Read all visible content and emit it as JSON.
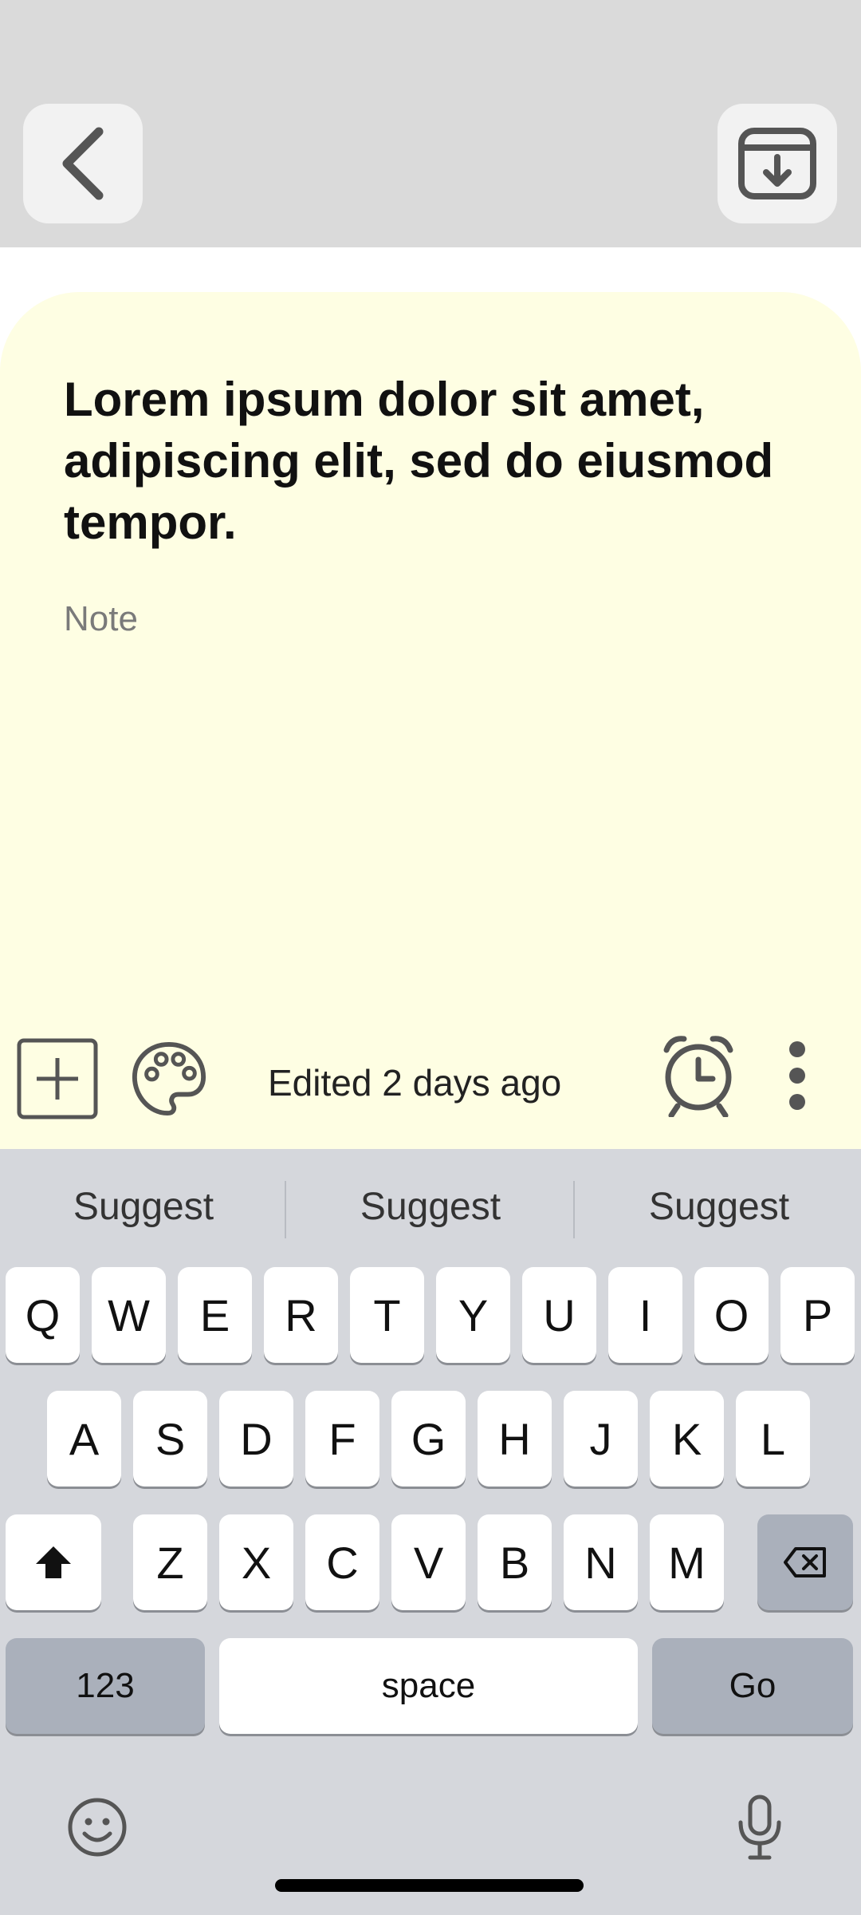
{
  "top_bar": {
    "back_icon": "chevron-left-icon",
    "save_icon": "archive-download-icon"
  },
  "note": {
    "title": "Lorem ipsum dolor sit amet, adipiscing elit, sed do eiusmod tempor.",
    "body_placeholder": "Note",
    "background_color": "#fefee3"
  },
  "toolbar": {
    "edited_text": "Edited 2 days ago",
    "icons": [
      "add-box-icon",
      "palette-icon",
      "alarm-icon",
      "more-vert-icon"
    ]
  },
  "keyboard": {
    "suggestions": [
      "Suggest",
      "Suggest",
      "Suggest"
    ],
    "row1": [
      "Q",
      "W",
      "E",
      "R",
      "T",
      "Y",
      "U",
      "I",
      "O",
      "P"
    ],
    "row2": [
      "A",
      "S",
      "D",
      "F",
      "G",
      "H",
      "J",
      "K",
      "L"
    ],
    "row3": [
      "Z",
      "X",
      "C",
      "V",
      "B",
      "N",
      "M"
    ],
    "numbers_label": "123",
    "space_label": "space",
    "go_label": "Go",
    "icons": [
      "shift-icon",
      "backspace-icon",
      "emoji-icon",
      "microphone-icon"
    ]
  }
}
